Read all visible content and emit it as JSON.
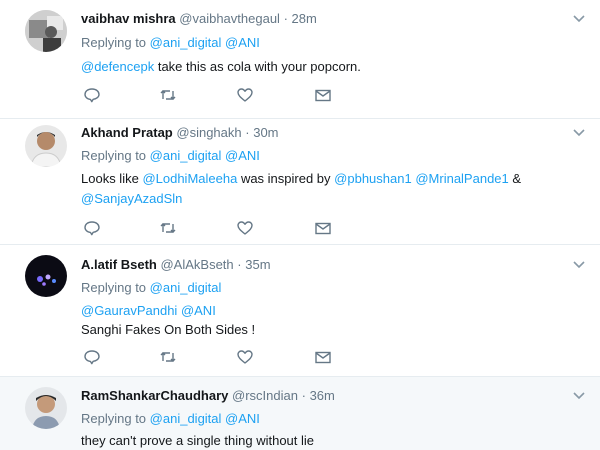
{
  "tweets": [
    {
      "name": "vaibhav mishra",
      "handle": "@vaibhavthegaul",
      "sep": "·",
      "time": "28m",
      "reply_prefix": "Replying to",
      "reply_to": [
        "@ani_digital",
        "@ANI"
      ],
      "text": {
        "m1": "@defencepk",
        "t1": "take this as cola with your popcorn."
      }
    },
    {
      "name": "Akhand Pratap",
      "handle": "@singhakh",
      "sep": "·",
      "time": "30m",
      "reply_prefix": "Replying to",
      "reply_to": [
        "@ani_digital",
        "@ANI"
      ],
      "text": {
        "t1": "Looks like",
        "m1": "@LodhiMaleeha",
        "t2": "was inspired by",
        "m2": "@pbhushan1",
        "m3": "@MrinalPande1",
        "t3": "&",
        "m4": "@SanjayAzadSln"
      }
    },
    {
      "name": "A.latif Bseth",
      "handle": "@AlAkBseth",
      "sep": "·",
      "time": "35m",
      "reply_prefix": "Replying to",
      "reply_to": [
        "@ani_digital"
      ],
      "text": {
        "m1": "@GauravPandhi",
        "m2": "@ANI",
        "t1": "Sanghi Fakes On Both Sides !"
      }
    },
    {
      "name": "RamShankarChaudhary",
      "handle": "@rscIndian",
      "sep": "·",
      "time": "36m",
      "reply_prefix": "Replying to",
      "reply_to": [
        "@ani_digital",
        "@ANI"
      ],
      "text": {
        "t1": "they can't prove a single thing without lie"
      }
    }
  ],
  "icons": {
    "reply": "reply-icon",
    "retweet": "retweet-icon",
    "like": "heart-icon",
    "dm": "envelope-icon",
    "more": "chevron-down-icon"
  },
  "colors": {
    "link": "#1da1f2",
    "secondary_text": "#657786",
    "highlight_bg": "#f5f8fa",
    "divider": "#e6ecf0"
  }
}
